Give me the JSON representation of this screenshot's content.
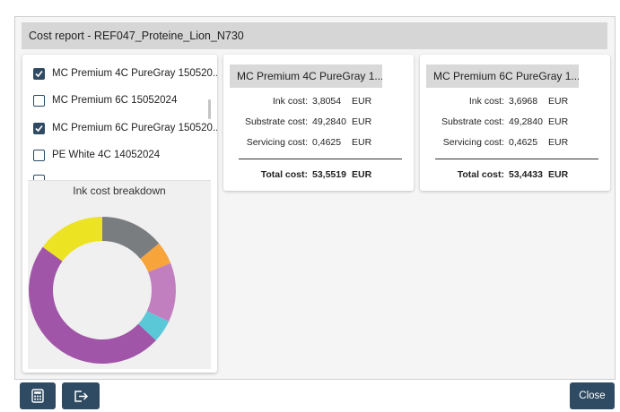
{
  "dialog": {
    "title": "Cost report - REF047_Proteine_Lion_N730"
  },
  "checklist": {
    "items": [
      {
        "label": "MC Premium 4C PureGray 150520...",
        "checked": true
      },
      {
        "label": "MC Premium 6C 15052024",
        "checked": false
      },
      {
        "label": "MC Premium 6C PureGray 150520...",
        "checked": true
      },
      {
        "label": "PE White 4C 14052024",
        "checked": false
      }
    ]
  },
  "chart_data": {
    "type": "pie",
    "title": "Ink cost breakdown",
    "donut": true,
    "slices": [
      {
        "value": 14,
        "color": "#7a7d80"
      },
      {
        "value": 5,
        "color": "#f7a43a"
      },
      {
        "value": 13,
        "color": "#c27fbf"
      },
      {
        "value": 5,
        "color": "#5bc8d8"
      },
      {
        "value": 48,
        "color": "#a155a8"
      },
      {
        "value": 15,
        "color": "#ece323"
      }
    ]
  },
  "cards": [
    {
      "title": "MC Premium 4C PureGray 1...",
      "ink_label": "Ink cost:",
      "ink_value": "3,8054",
      "ink_unit": "EUR",
      "substrate_label": "Substrate cost:",
      "substrate_value": "49,2840",
      "substrate_unit": "EUR",
      "servicing_label": "Servicing cost:",
      "servicing_value": "0,4625",
      "servicing_unit": "EUR",
      "total_label": "Total cost:",
      "total_value": "53,5519",
      "total_unit": "EUR"
    },
    {
      "title": "MC Premium 6C PureGray 1...",
      "ink_label": "Ink cost:",
      "ink_value": "3,6968",
      "ink_unit": "EUR",
      "substrate_label": "Substrate cost:",
      "substrate_value": "49,2840",
      "substrate_unit": "EUR",
      "servicing_label": "Servicing cost:",
      "servicing_value": "0,4625",
      "servicing_unit": "EUR",
      "total_label": "Total cost:",
      "total_value": "53,4433",
      "total_unit": "EUR"
    }
  ],
  "footer": {
    "calculator_icon": "calculator-icon",
    "export_icon": "export-icon",
    "close_label": "Close"
  },
  "colors": {
    "accent": "#2f4b63",
    "titlebar": "#d6d6d6"
  }
}
